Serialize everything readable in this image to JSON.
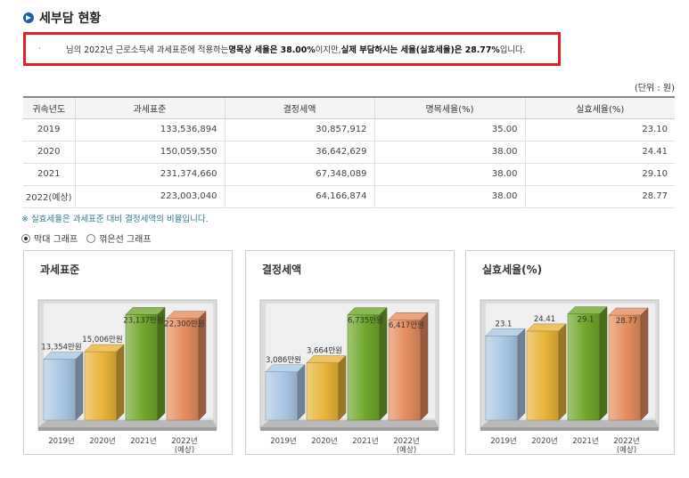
{
  "header": {
    "title": "세부담 현황"
  },
  "summary": {
    "prefix": "·",
    "part1": "님의 2022년 근로소득세 과세표준에 적용하는 ",
    "bold1": "명목상 세율은 38.00%",
    "part2": "이지만, ",
    "bold2": "실제 부담하시는 세율(실효세율)은 28.77%",
    "part3": "입니다."
  },
  "unit_note": "(단위 : 원)",
  "table": {
    "headers": [
      "귀속년도",
      "과세표준",
      "결정세액",
      "명목세율(%)",
      "실효세율(%)"
    ],
    "rows": [
      [
        "2019",
        "133,536,894",
        "30,857,912",
        "35.00",
        "23.10"
      ],
      [
        "2020",
        "150,059,550",
        "36,642,629",
        "38.00",
        "24.41"
      ],
      [
        "2021",
        "231,374,660",
        "67,348,089",
        "38.00",
        "29.10"
      ],
      [
        "2022(예상)",
        "223,003,040",
        "64,166,874",
        "38.00",
        "28.77"
      ]
    ]
  },
  "footnote": "※ 실효세율은 과세표준 대비 결정세액의 비율입니다.",
  "graph_toggle": {
    "bar_label": "막대 그래프",
    "line_label": "꺾은선 그래프",
    "selected": "bar"
  },
  "chart_data": [
    {
      "type": "bar",
      "title": "과세표준",
      "categories": [
        "2019년",
        "2020년",
        "2021년",
        "2022년\n(예상)"
      ],
      "values": [
        13354,
        15006,
        23137,
        22300
      ],
      "labels": [
        "13,354만원",
        "15,006만원",
        "23,137만원",
        "22,300만원"
      ],
      "ylim": [
        0,
        24000
      ],
      "colors": [
        "#aac8e4",
        "#e8b53a",
        "#6fa82a",
        "#e58d5f"
      ]
    },
    {
      "type": "bar",
      "title": "결정세액",
      "categories": [
        "2019년",
        "2020년",
        "2021년",
        "2022년\n(예상)"
      ],
      "values": [
        3086,
        3664,
        6735,
        6417
      ],
      "labels": [
        "3,086만원",
        "3,664만원",
        "6,735만원",
        "6,417만원"
      ],
      "ylim": [
        0,
        7000
      ],
      "colors": [
        "#aac8e4",
        "#e8b53a",
        "#6fa82a",
        "#e58d5f"
      ]
    },
    {
      "type": "bar",
      "title": "실효세율(%)",
      "categories": [
        "2019년",
        "2020년",
        "2021년",
        "2022년\n(예상)"
      ],
      "values": [
        23.1,
        24.41,
        29.1,
        28.77
      ],
      "labels": [
        "23.1",
        "24.41",
        "29.1",
        "28.77"
      ],
      "ylim": [
        0,
        30
      ],
      "colors": [
        "#aac8e4",
        "#e8b53a",
        "#6fa82a",
        "#e58d5f"
      ]
    }
  ]
}
